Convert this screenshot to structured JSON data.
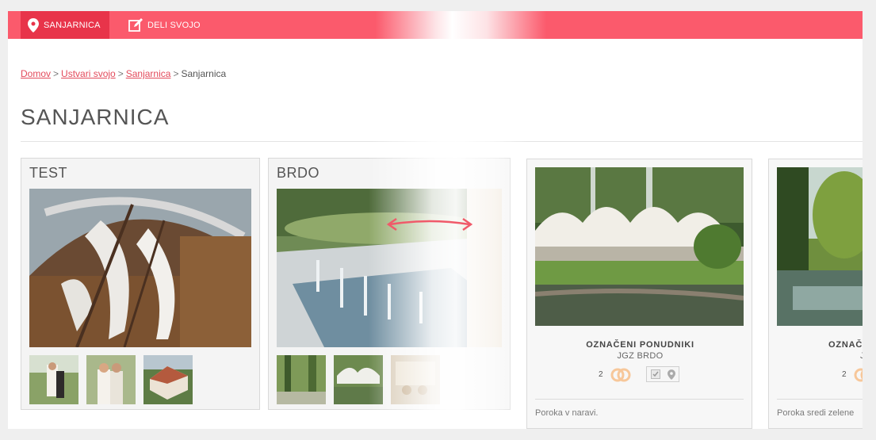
{
  "nav": {
    "items": [
      {
        "label": "SANJARNICA",
        "icon": "pin-icon"
      },
      {
        "label": "DELI SVOJO",
        "icon": "edit-icon"
      }
    ]
  },
  "breadcrumb": {
    "links": [
      "Domov",
      "Ustvari svojo",
      "Sanjarnica"
    ],
    "current": "Sanjarnica",
    "separator": ">"
  },
  "page": {
    "title": "SANJARNICA"
  },
  "cards": [
    {
      "title": "TEST"
    },
    {
      "title": "BRDO"
    }
  ],
  "vendors": [
    {
      "label": "OZNAČENI PONUDNIKI",
      "name": "JGZ BRDO",
      "count": "2",
      "description": "Poroka v naravi."
    },
    {
      "label": "OZNAČE",
      "name": "J",
      "count": "2",
      "description": "Poroka sredi zelene"
    }
  ],
  "colors": {
    "accent": "#fb5a6c",
    "accent_dark": "#e8344a",
    "ring": "#f7c79a"
  }
}
